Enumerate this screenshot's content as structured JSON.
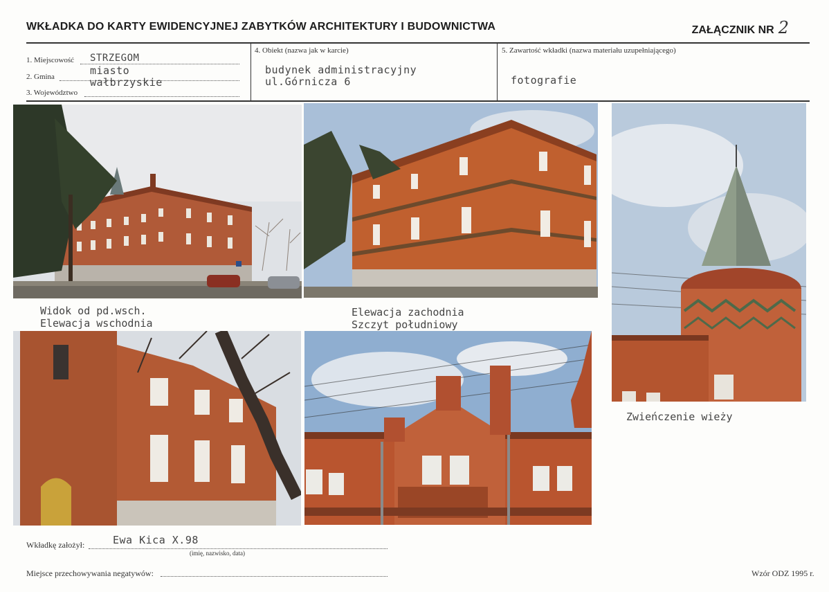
{
  "header": {
    "title": "WKŁADKA DO KARTY EWIDENCYJNEJ ZABYTKÓW ARCHITEKTURY I BUDOWNICTWA",
    "annex_label": "ZAŁĄCZNIK NR",
    "annex_number": "2"
  },
  "form": {
    "field1_label": "1. Miejscowość",
    "field2_label": "2. Gmina",
    "field3_label": "3. Województwo",
    "field1_value": "STRZEGOM",
    "field2_value": "miasto",
    "field3_value": "wałbrzyskie",
    "field4_label": "4. Obiekt (nazwa jak w karcie)",
    "field4_line1": "budynek administracyjny",
    "field4_line2": "ul.Górnicza 6",
    "field5_label": "5. Zawartość wkładki (nazwa materiału uzupełniającego)",
    "field5_value": "fotografie"
  },
  "captions": {
    "photo1_line1": "Widok od pd.wsch.",
    "photo1_line2": "Elewacja wschodnia",
    "photo2_line1": "Elewacja zachodnia",
    "photo2_line2": "Szczyt południowy",
    "photo3": "Zwieńczenie wieży"
  },
  "footer": {
    "author_label": "Wkładkę założył:",
    "author_value": "Ewa Kica X.98",
    "author_hint": "(imię, nazwisko, data)",
    "negatives_label": "Miejsce przechowywania negatywów:",
    "form_model": "Wzór ODZ 1995 r."
  },
  "colors": {
    "brick": "#b85a34",
    "brick_dark": "#8f3f24",
    "sky": "#c7d3e0",
    "tree": "#2f3b2a",
    "stone": "#cfcac2"
  }
}
